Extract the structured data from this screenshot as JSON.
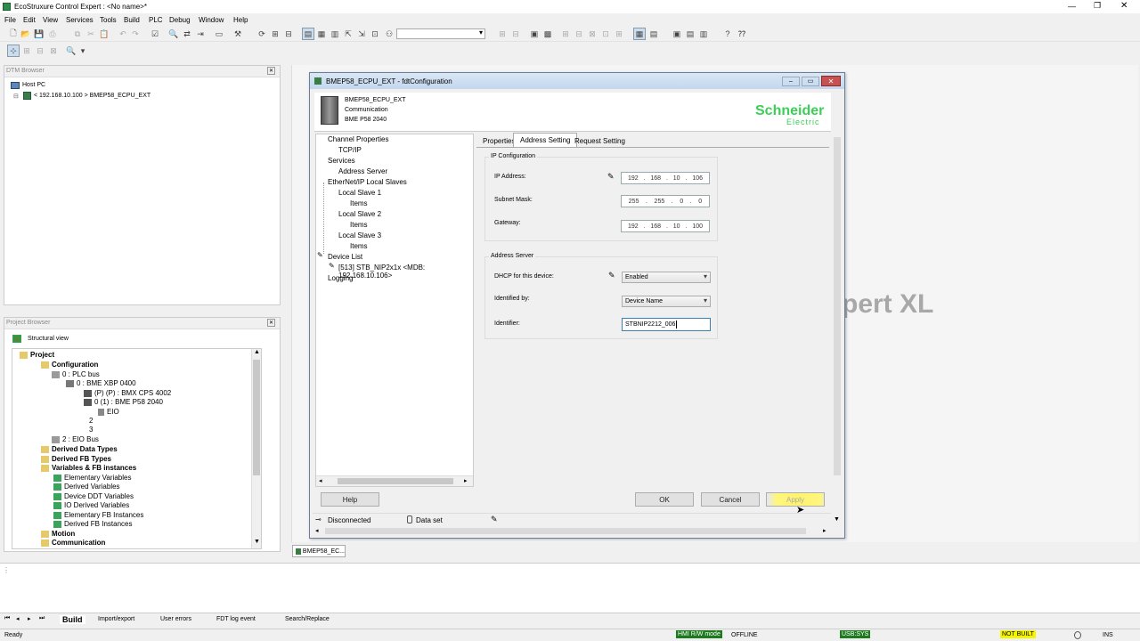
{
  "titlebar": {
    "title": "EcoStruxure Control Expert : <No name>*"
  },
  "menu": [
    "File",
    "Edit",
    "View",
    "Services",
    "Tools",
    "Build",
    "PLC",
    "Debug",
    "Window",
    "Help"
  ],
  "dtm_browser": {
    "title": "DTM Browser",
    "host": "Host PC",
    "device": "< 192.168.10.100 > BMEP58_ECPU_EXT"
  },
  "project_browser": {
    "title": "Project Browser",
    "view": "Structural view",
    "items": [
      {
        "label": "Project",
        "bold": true
      },
      {
        "label": "Configuration",
        "bold": true
      },
      {
        "label": "0 : PLC bus",
        "bold": false
      },
      {
        "label": "0 : BME XBP 0400",
        "bold": false
      },
      {
        "label": "(P) (P) : BMX CPS 4002",
        "bold": false
      },
      {
        "label": "0 (1) : BME P58 2040",
        "bold": false
      },
      {
        "label": "EIO",
        "bold": false
      },
      {
        "label": "2",
        "bold": false
      },
      {
        "label": "3",
        "bold": false
      },
      {
        "label": "2 : EIO Bus",
        "bold": false
      },
      {
        "label": "Derived Data Types",
        "bold": true
      },
      {
        "label": "Derived FB Types",
        "bold": true
      },
      {
        "label": "Variables & FB instances",
        "bold": true
      },
      {
        "label": "Elementary Variables",
        "bold": false
      },
      {
        "label": "Derived Variables",
        "bold": false
      },
      {
        "label": "Device DDT Variables",
        "bold": false
      },
      {
        "label": "IO Derived Variables",
        "bold": false
      },
      {
        "label": "Elementary FB Instances",
        "bold": false
      },
      {
        "label": "Derived FB Instances",
        "bold": false
      },
      {
        "label": "Motion",
        "bold": true
      },
      {
        "label": "Communication",
        "bold": true
      }
    ]
  },
  "dialog": {
    "title": "BMEP58_ECPU_EXT - fdtConfiguration",
    "device_name": "BMEP58_ECPU_EXT",
    "device_type": "Communication",
    "device_model": "BME P58 2040",
    "brand_line1": "Schneider",
    "brand_line2": "Electric",
    "nav": [
      "Channel Properties",
      "TCP/IP",
      "Services",
      "Address Server",
      "EtherNet/IP Local Slaves",
      "Local Slave 1",
      "Items",
      "Local Slave 2",
      "Items",
      "Local Slave 3",
      "Items",
      "Device List",
      "[513] STB_NIP2x1x <MDB: 192.168.10.106>",
      "Logging"
    ],
    "tabs": [
      "Properties",
      "Address Setting",
      "Request Setting"
    ],
    "ip_config": {
      "group_label": "IP Configuration",
      "ip_label": "IP Address:",
      "ip": [
        "192",
        "168",
        "10",
        "106"
      ],
      "subnet_label": "Subnet Mask:",
      "subnet": [
        "255",
        "255",
        "0",
        "0"
      ],
      "gateway_label": "Gateway:",
      "gateway": [
        "192",
        "168",
        "10",
        "100"
      ]
    },
    "address_server": {
      "group_label": "Address Server",
      "dhcp_label": "DHCP for this device:",
      "dhcp_value": "Enabled",
      "identified_label": "Identified by:",
      "identified_value": "Device Name",
      "identifier_label": "Identifier:",
      "identifier_value": "STBNIP2212_006"
    },
    "buttons": {
      "help": "Help",
      "ok": "OK",
      "cancel": "Cancel",
      "apply": "Apply"
    },
    "status": {
      "connection": "Disconnected",
      "dataset": "Data set"
    }
  },
  "background_text": "pert XL",
  "doc_tab": "BMEP58_EC...",
  "output_tabs": [
    "Build",
    "Import/export",
    "User errors",
    "FDT log event",
    "Search/Replace"
  ],
  "statusbar": {
    "left": "Ready",
    "hmi": "HMI R/W mode",
    "offline": "OFFLINE",
    "usb": "USB:SYS",
    "not_built": "NOT BUILT",
    "ins": "INS"
  },
  "colors": {
    "status_green": "#1e7a1e",
    "status_yellow": "#f5f500",
    "schneider_green": "#3dcd58",
    "title_blue": "#cfe0f4"
  }
}
